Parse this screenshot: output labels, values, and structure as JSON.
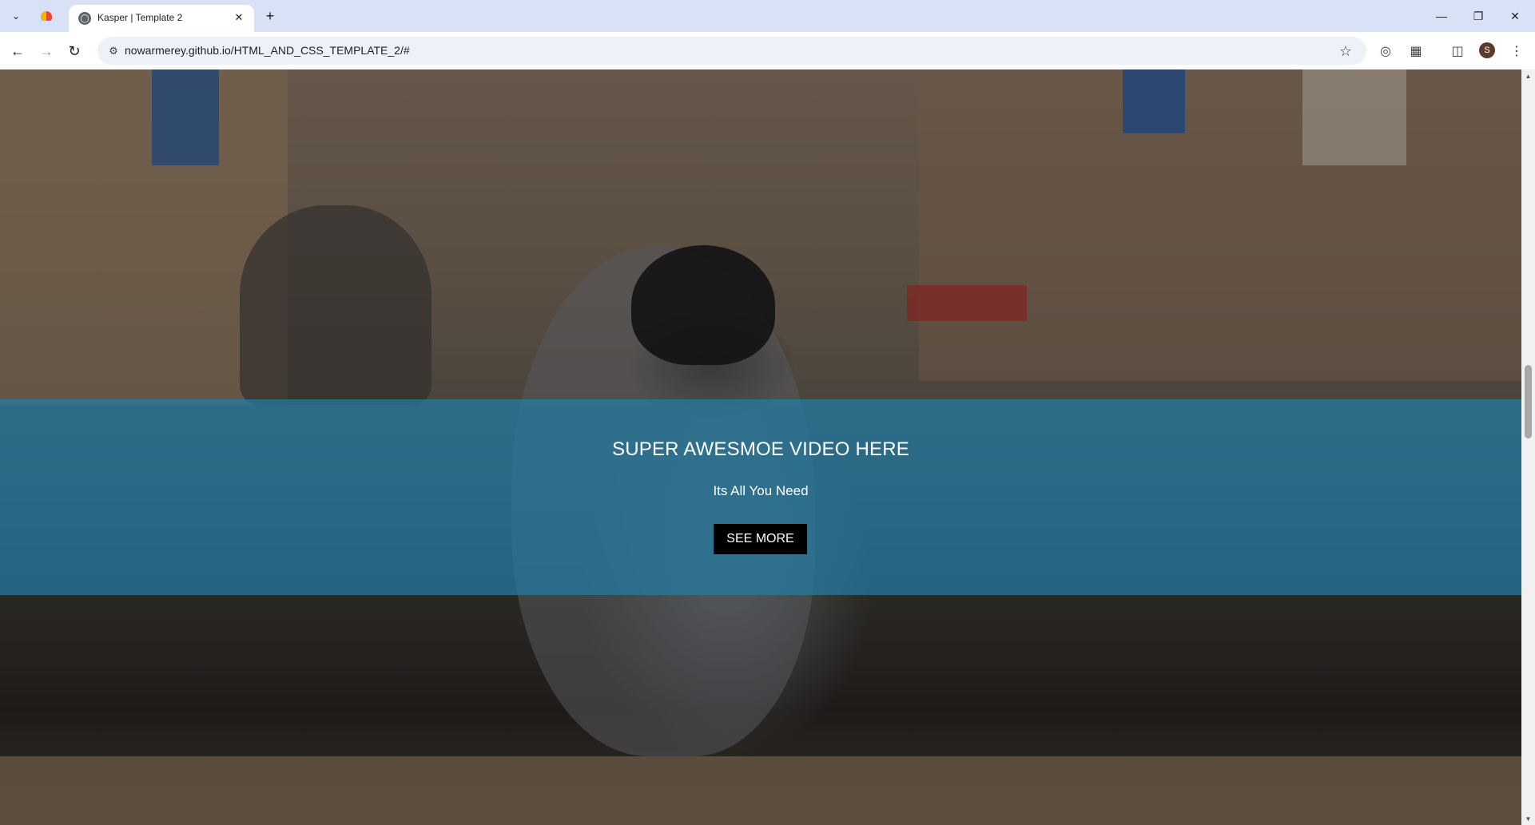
{
  "browser": {
    "tab_title": "Kasper | Template 2",
    "url": "nowarmerey.github.io/HTML_AND_CSS_TEMPLATE_2/#",
    "profile_initial": "S"
  },
  "hero": {
    "title": "SUPER AWESMOE VIDEO HERE",
    "subtitle": "Its All You Need",
    "button_label": "SEE MORE"
  },
  "colors": {
    "band": "#237da5",
    "button_bg": "#000000",
    "text": "#ffffff"
  }
}
